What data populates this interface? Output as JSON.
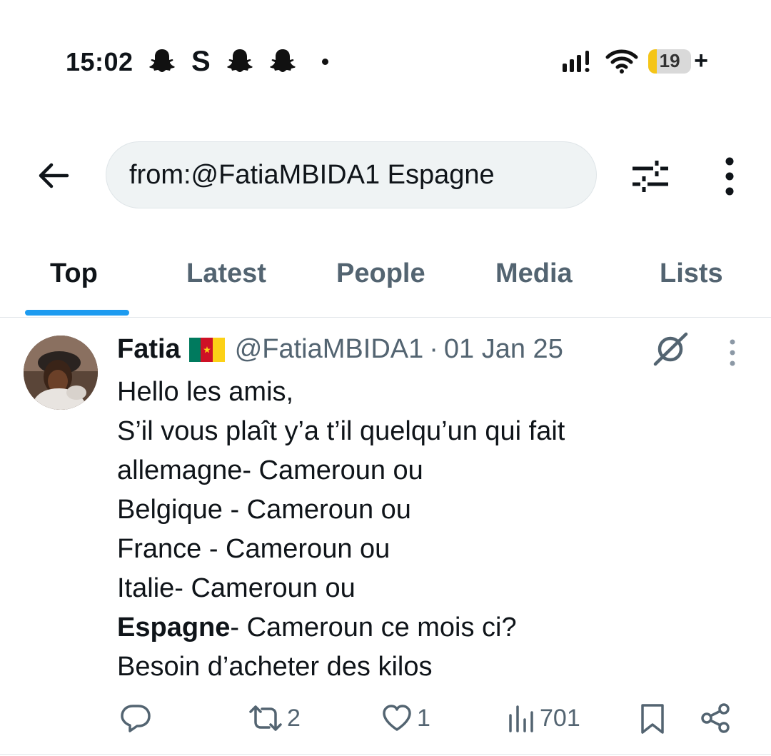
{
  "status_bar": {
    "time": "15:02",
    "app_icons": [
      "snapchat-icon",
      "s-letter-icon",
      "snapchat-icon",
      "snapchat-icon",
      "dot-icon"
    ],
    "s_letter": "S",
    "battery": "19",
    "battery_plus": "+",
    "battery_fill_percent": 19
  },
  "search": {
    "value": "from:@FatiaMBIDA1 Espagne"
  },
  "tabs": [
    {
      "label": "Top",
      "active": true
    },
    {
      "label": "Latest",
      "active": false
    },
    {
      "label": "People",
      "active": false
    },
    {
      "label": "Media",
      "active": false
    },
    {
      "label": "Lists",
      "active": false
    }
  ],
  "tweet": {
    "author_name": "Fatia",
    "flag_colors": [
      "#007a5e",
      "#ce1126",
      "#fcd116"
    ],
    "handle": "@FatiaMBIDA1",
    "separator": "·",
    "date": "01 Jan 25",
    "lines": [
      "Hello les amis,",
      "S’il vous plaît y’a t’il quelqu’un qui fait",
      "allemagne- Cameroun ou",
      "Belgique - Cameroun ou",
      "France - Cameroun ou",
      "Italie- Cameroun ou"
    ],
    "highlight_word": "Espagne",
    "highlight_rest": "- Cameroun ce mois ci?",
    "last_line": "Besoin d’acheter des kilos",
    "retweets": "2",
    "likes": "1",
    "views": "701"
  },
  "colors": {
    "accent": "#1d9bf0",
    "secondary_text": "#536471",
    "search_bg": "#eff3f4"
  }
}
